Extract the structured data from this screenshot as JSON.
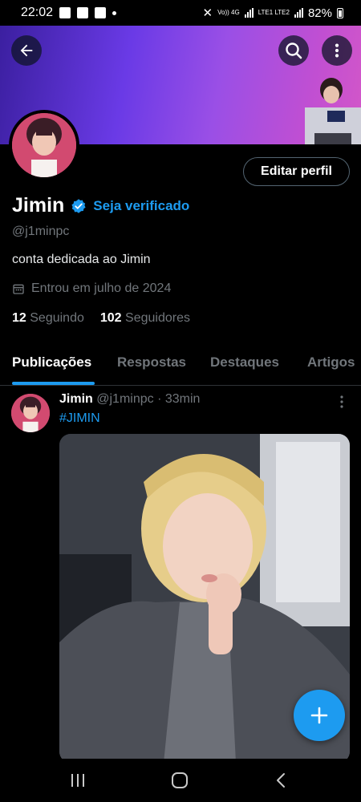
{
  "status_bar": {
    "time": "22:02",
    "net_label_1": "Vo)) 4G",
    "net_label_2": "LTE1 LTE2",
    "battery": "82%",
    "battery_level": 0.82
  },
  "header": {
    "back_icon": "arrow-left-icon",
    "search_icon": "search-icon",
    "more_icon": "more-vertical-icon",
    "banner_colors": [
      "#3b1fa0",
      "#6a3ae6",
      "#c14fd2"
    ]
  },
  "profile": {
    "edit_button": "Editar perfil",
    "name": "Jimin",
    "verify_label": "Seja verificado",
    "handle": "@j1minpc",
    "bio": "conta dedicada ao Jimin",
    "joined": "Entrou em julho de 2024",
    "following_count": "12",
    "following_label": "Seguindo",
    "followers_count": "102",
    "followers_label": "Seguidores"
  },
  "tabs": [
    {
      "label": "Publicações",
      "active": true
    },
    {
      "label": "Respostas",
      "active": false
    },
    {
      "label": "Destaques",
      "active": false
    },
    {
      "label": "Artigos",
      "active": false
    }
  ],
  "post": {
    "author": "Jimin",
    "handle_time": "@j1minpc · 33min",
    "text": "#JIMIN"
  },
  "colors": {
    "accent": "#1d9bf0",
    "background": "#000000",
    "muted": "#71767b"
  }
}
